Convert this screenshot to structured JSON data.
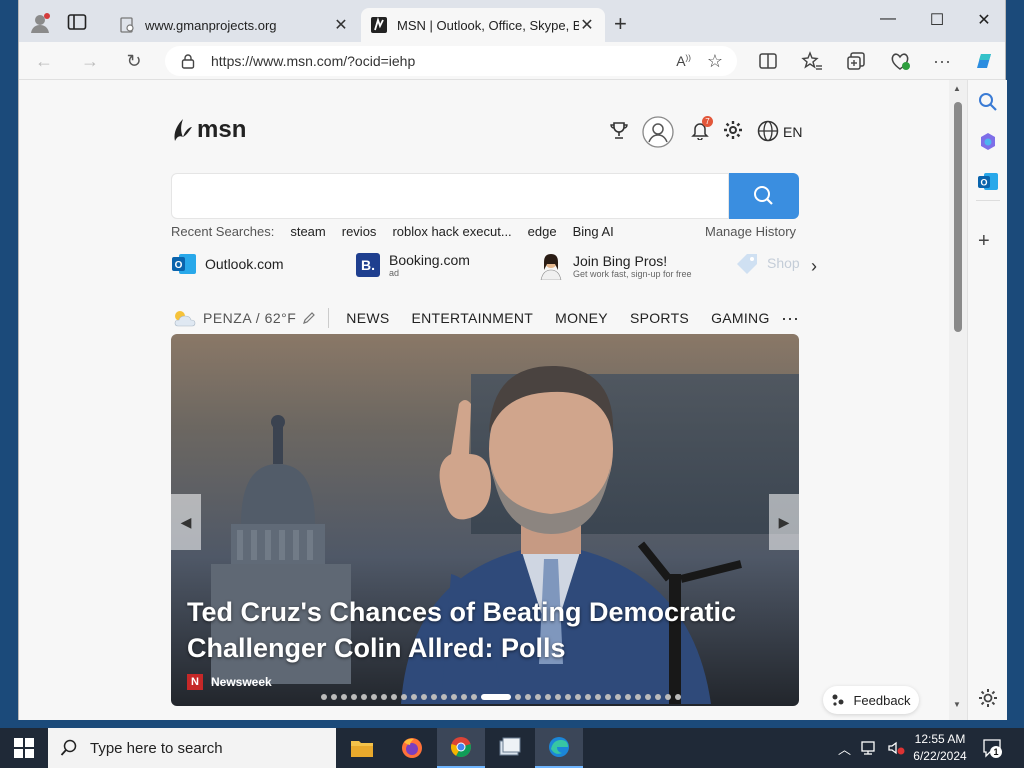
{
  "browser": {
    "tabs": [
      {
        "title": "www.gmanprojects.org",
        "active": false
      },
      {
        "title": "MSN | Outlook, Office, Skype, Bi",
        "active": true
      }
    ],
    "address": "https://www.msn.com/?ocid=iehp"
  },
  "msn": {
    "logo": "msn",
    "language": "EN",
    "notification_count": "7",
    "recent_label": "Recent Searches:",
    "recent_searches": [
      "steam",
      "revios",
      "roblox hack execut...",
      "edge",
      "Bing AI"
    ],
    "manage_history": "Manage History",
    "quick_links": [
      {
        "label": "Outlook.com",
        "sub": ""
      },
      {
        "label": "Booking.com",
        "sub": "ad"
      },
      {
        "label": "Join Bing Pros!",
        "sub": "Get work fast, sign-up for free"
      },
      {
        "label": "Shop",
        "sub": ""
      }
    ],
    "weather": "PENZA / 62°F",
    "nav": [
      "NEWS",
      "ENTERTAINMENT",
      "MONEY",
      "SPORTS",
      "GAMING"
    ],
    "more": "···",
    "hero": {
      "headline": "Ted Cruz's Chances of Beating Democratic Challenger Colin Allred: Polls",
      "source": "Newsweek",
      "source_badge": "N",
      "slide_count": 34,
      "active_slide": 16
    },
    "feedback": "Feedback"
  },
  "taskbar": {
    "search_placeholder": "Type here to search",
    "time": "12:55 AM",
    "date": "6/22/2024",
    "notification_count": "1"
  }
}
